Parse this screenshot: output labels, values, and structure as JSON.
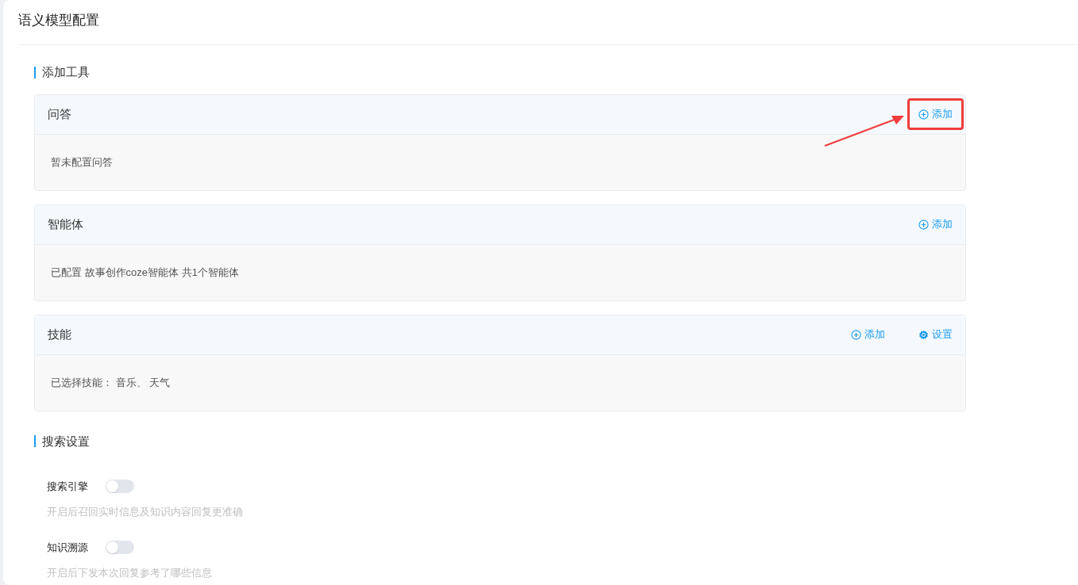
{
  "page_title": "语义模型配置",
  "tools_section": {
    "title": "添加工具",
    "cards": [
      {
        "title": "问答",
        "body": "暂未配置问答",
        "actions": [
          {
            "kind": "add",
            "label": "添加",
            "annotated": true
          }
        ]
      },
      {
        "title": "智能体",
        "body": "已配置 故事创作coze智能体 共1个智能体",
        "actions": [
          {
            "kind": "add",
            "label": "添加",
            "annotated": false
          }
        ]
      },
      {
        "title": "技能",
        "body": "已选择技能： 音乐、 天气",
        "actions": [
          {
            "kind": "add",
            "label": "添加",
            "annotated": false
          },
          {
            "kind": "settings",
            "label": "设置",
            "annotated": false
          }
        ]
      }
    ]
  },
  "search_section": {
    "title": "搜索设置",
    "settings": [
      {
        "label": "搜索引擎",
        "on": false,
        "hint": "开启后召回实时信息及知识内容回复更准确"
      },
      {
        "label": "知识溯源",
        "on": false,
        "hint": "开启后下发本次回复参考了哪些信息"
      }
    ]
  }
}
